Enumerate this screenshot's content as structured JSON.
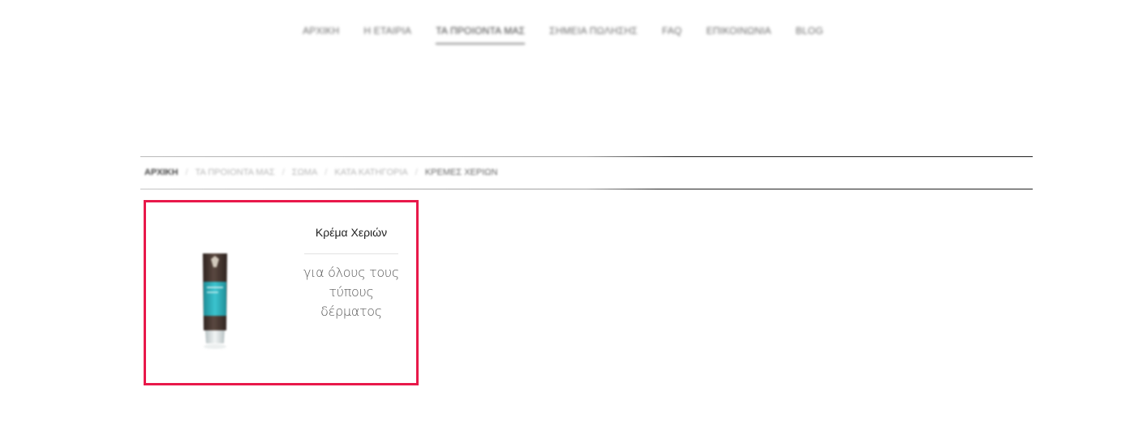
{
  "nav": {
    "items": [
      {
        "label": "ΑΡΧΙΚΗ",
        "active": false
      },
      {
        "label": "Η ΕΤΑΙΡΙΑ",
        "active": false
      },
      {
        "label": "ΤΑ ΠΡΟΙΟΝΤΑ ΜΑΣ",
        "active": true
      },
      {
        "label": "ΣΗΜΕΙΑ ΠΩΛΗΣΗΣ",
        "active": false
      },
      {
        "label": "FAQ",
        "active": false
      },
      {
        "label": "ΕΠΙΚΟΙΝΩΝΙΑ",
        "active": false
      },
      {
        "label": "BLOG",
        "active": false
      }
    ]
  },
  "breadcrumb": {
    "items": [
      "ΑΡΧΙΚΗ",
      "ΤΑ ΠΡΟΙΟΝΤΑ ΜΑΣ",
      "ΣΩΜΑ",
      "ΚΑΤΑ ΚΑΤΗΓΟΡΙΑ",
      "ΚΡΕΜΕΣ ΧΕΡΙΩΝ"
    ],
    "separator": "/"
  },
  "product": {
    "title": "Κρέμα Χεριών",
    "description": "για όλους τους τύπους δέρματος",
    "image_icon": "hand-cream-tube-icon"
  },
  "colors": {
    "accent_border": "#e8184a",
    "tube_body": "#4a3a33",
    "tube_label": "#2fb3bf"
  }
}
